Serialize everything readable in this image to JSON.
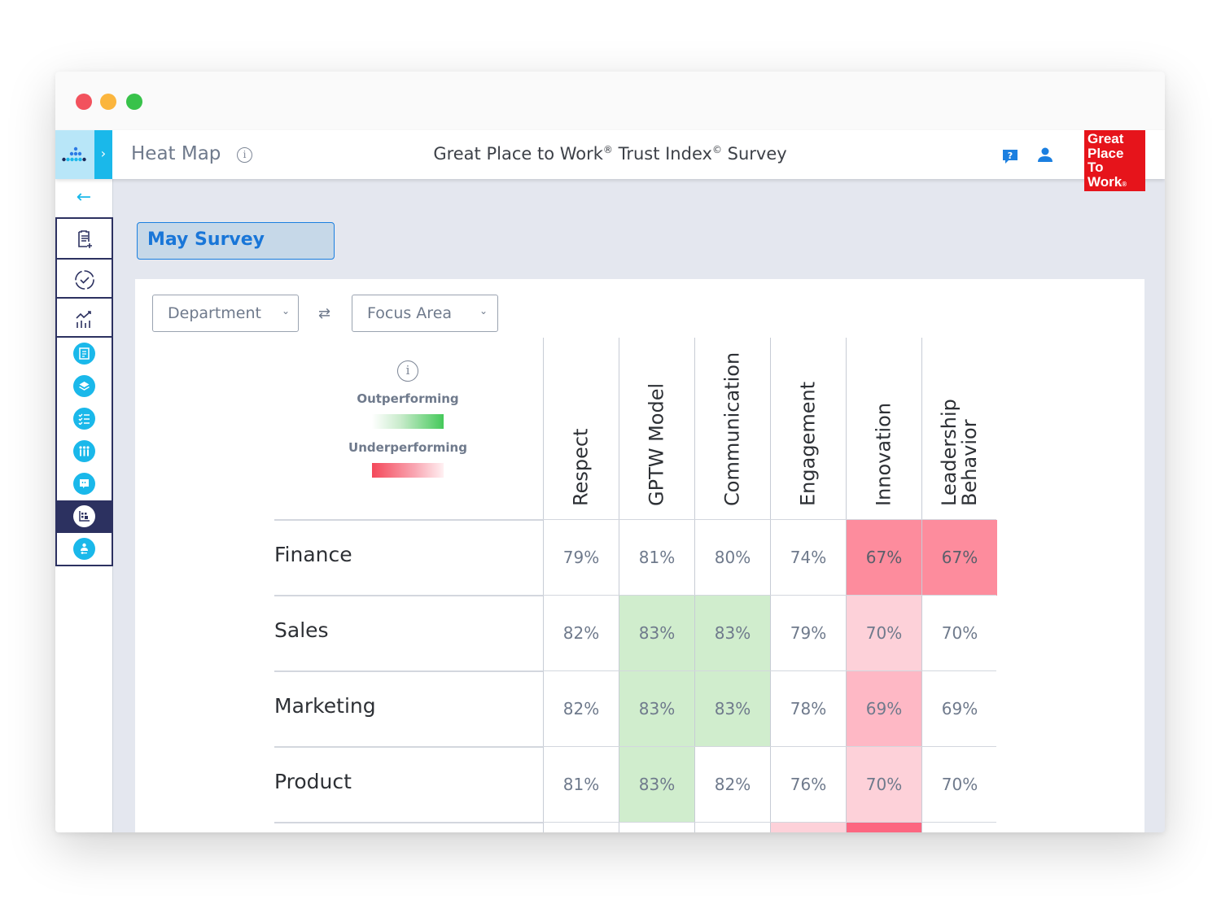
{
  "window": {
    "controls": [
      "close",
      "minimize",
      "maximize"
    ],
    "colors": {
      "close": "#f2525d",
      "minimize": "#fbb53d",
      "maximize": "#38c24a"
    }
  },
  "header": {
    "page_title": "Heat Map",
    "page_info_icon": "info-icon",
    "survey_title_parts": [
      "Great Place to Work",
      "®",
      " Trust Index",
      "©",
      " Survey"
    ],
    "help_icon": "chat-help-icon",
    "user_icon": "user-icon",
    "logo_lines": [
      "Great",
      "Place",
      "To",
      "Work"
    ],
    "logo_mark": "®",
    "brand_color": "#e6141b",
    "accent_color": "#1ab8ea"
  },
  "sidebar": {
    "back_icon": "arrow-left-icon",
    "items": [
      {
        "icon": "clipboard-add-icon"
      },
      {
        "icon": "check-circle-dashed-icon"
      },
      {
        "icon": "chart-trend-icon"
      },
      {
        "icon": "document-list-icon"
      },
      {
        "icon": "layers-icon"
      },
      {
        "icon": "checklist-icon"
      },
      {
        "icon": "people-group-icon"
      },
      {
        "icon": "comment-quote-icon"
      },
      {
        "icon": "heatmap-icon",
        "active": true
      },
      {
        "icon": "user-key-icon"
      }
    ]
  },
  "main": {
    "survey_chip": "May Survey",
    "row_dimension": "Department",
    "column_dimension": "Focus Area",
    "swap_icon": "swap-arrows-icon",
    "legend": {
      "info_icon": "info-icon",
      "outperforming_label": "Outperforming",
      "underperforming_label": "Underperforming"
    }
  },
  "chart_data": {
    "type": "heatmap",
    "title": "Heat Map",
    "xlabel": "Focus Area",
    "ylabel": "Department",
    "columns": [
      "Respect",
      "GPTW Model",
      "Communication",
      "Engagement",
      "Innovation",
      "Leadership Behavior"
    ],
    "rows": [
      {
        "label": "Finance",
        "values": [
          "79%",
          "81%",
          "80%",
          "74%",
          "67%",
          "67%"
        ],
        "status": [
          "neutral",
          "neutral",
          "neutral",
          "neutral",
          "under-strong",
          "under-strong"
        ]
      },
      {
        "label": "Sales",
        "values": [
          "82%",
          "83%",
          "83%",
          "79%",
          "70%",
          "70%"
        ],
        "status": [
          "neutral",
          "out",
          "out",
          "neutral",
          "under-light",
          "neutral"
        ]
      },
      {
        "label": "Marketing",
        "values": [
          "82%",
          "83%",
          "83%",
          "78%",
          "69%",
          "69%"
        ],
        "status": [
          "neutral",
          "out",
          "out",
          "neutral",
          "under-medium",
          "neutral"
        ]
      },
      {
        "label": "Product",
        "values": [
          "81%",
          "83%",
          "82%",
          "76%",
          "70%",
          "70%"
        ],
        "status": [
          "neutral",
          "out",
          "neutral",
          "neutral",
          "under-light",
          "neutral"
        ]
      }
    ],
    "partial_row_status": [
      "neutral",
      "neutral",
      "neutral",
      "under-light",
      "under-strongest",
      "neutral"
    ],
    "status_colors": {
      "neutral": "#ffffff",
      "out": "#d0edcd",
      "under-light": "#fdd1d9",
      "under-medium": "#feb8c5",
      "under-strong": "#fd8c9d",
      "under-strongest": "#fc6680"
    },
    "legend": [
      {
        "label": "Outperforming",
        "gradient": [
          "#ffffff",
          "#45c95a"
        ]
      },
      {
        "label": "Underperforming",
        "gradient": [
          "#f4485a",
          "#fff0f2"
        ]
      }
    ]
  }
}
